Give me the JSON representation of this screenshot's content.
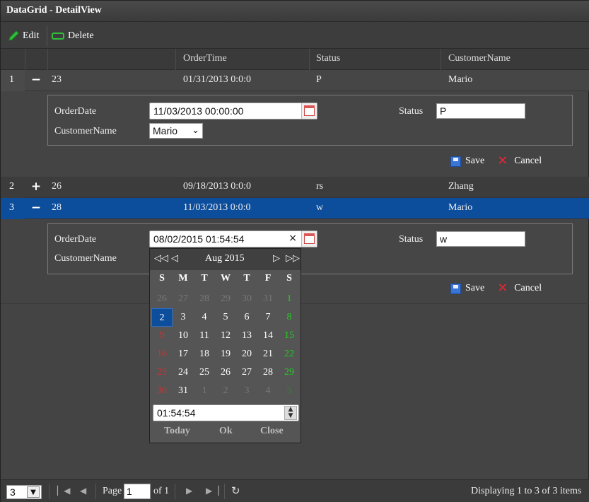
{
  "window": {
    "title": "DataGrid - DetailView"
  },
  "toolbar": {
    "edit_label": "Edit",
    "delete_label": "Delete"
  },
  "columns": [
    "OrderTime",
    "Status",
    "CustomerName"
  ],
  "rows": [
    {
      "num": "1",
      "expander": "−",
      "id": "23",
      "order_time": "01/31/2013 0:0:0",
      "status": "P",
      "customer": "Mario"
    },
    {
      "num": "2",
      "expander": "+",
      "id": "26",
      "order_time": "09/18/2013 0:0:0",
      "status": "rs",
      "customer": "Zhang"
    },
    {
      "num": "3",
      "expander": "−",
      "id": "28",
      "order_time": "11/03/2013 0:0:0",
      "status": "w",
      "customer": "Mario"
    }
  ],
  "detail1": {
    "order_date_label": "OrderDate",
    "order_date_value": "11/03/2013 00:00:00",
    "customer_label": "CustomerName",
    "customer_value": "Mario",
    "status_label": "Status",
    "status_value": "P",
    "save_label": "Save",
    "cancel_label": "Cancel"
  },
  "detail3": {
    "order_date_label": "OrderDate",
    "order_date_value": "08/02/2015 01:54:54",
    "clear_glyph": "×",
    "customer_label": "CustomerName",
    "status_label": "Status",
    "status_value": "w",
    "save_label": "Save",
    "cancel_label": "Cancel"
  },
  "calendar": {
    "month_title": "Aug 2015",
    "days_of_week": [
      "S",
      "M",
      "T",
      "W",
      "T",
      "F",
      "S"
    ],
    "weeks": [
      [
        "26",
        "27",
        "28",
        "29",
        "30",
        "31",
        "1"
      ],
      [
        "2",
        "3",
        "4",
        "5",
        "6",
        "7",
        "8"
      ],
      [
        "9",
        "10",
        "11",
        "12",
        "13",
        "14",
        "15"
      ],
      [
        "16",
        "17",
        "18",
        "19",
        "20",
        "21",
        "22"
      ],
      [
        "23",
        "24",
        "25",
        "26",
        "27",
        "28",
        "29"
      ],
      [
        "30",
        "31",
        "1",
        "2",
        "3",
        "4",
        "5"
      ]
    ],
    "time_value": "01:54:54",
    "today_label": "Today",
    "ok_label": "Ok",
    "close_label": "Close"
  },
  "pager": {
    "page_size": "3",
    "page_label": "Page",
    "page_value": "1",
    "of_label": "of 1",
    "display_text": "Displaying 1 to 3 of 3 items"
  },
  "colors": {
    "selected_row": "#0c4d9c",
    "saturday": "#22cc22",
    "sunday": "#cc3333",
    "background": "#444444"
  }
}
